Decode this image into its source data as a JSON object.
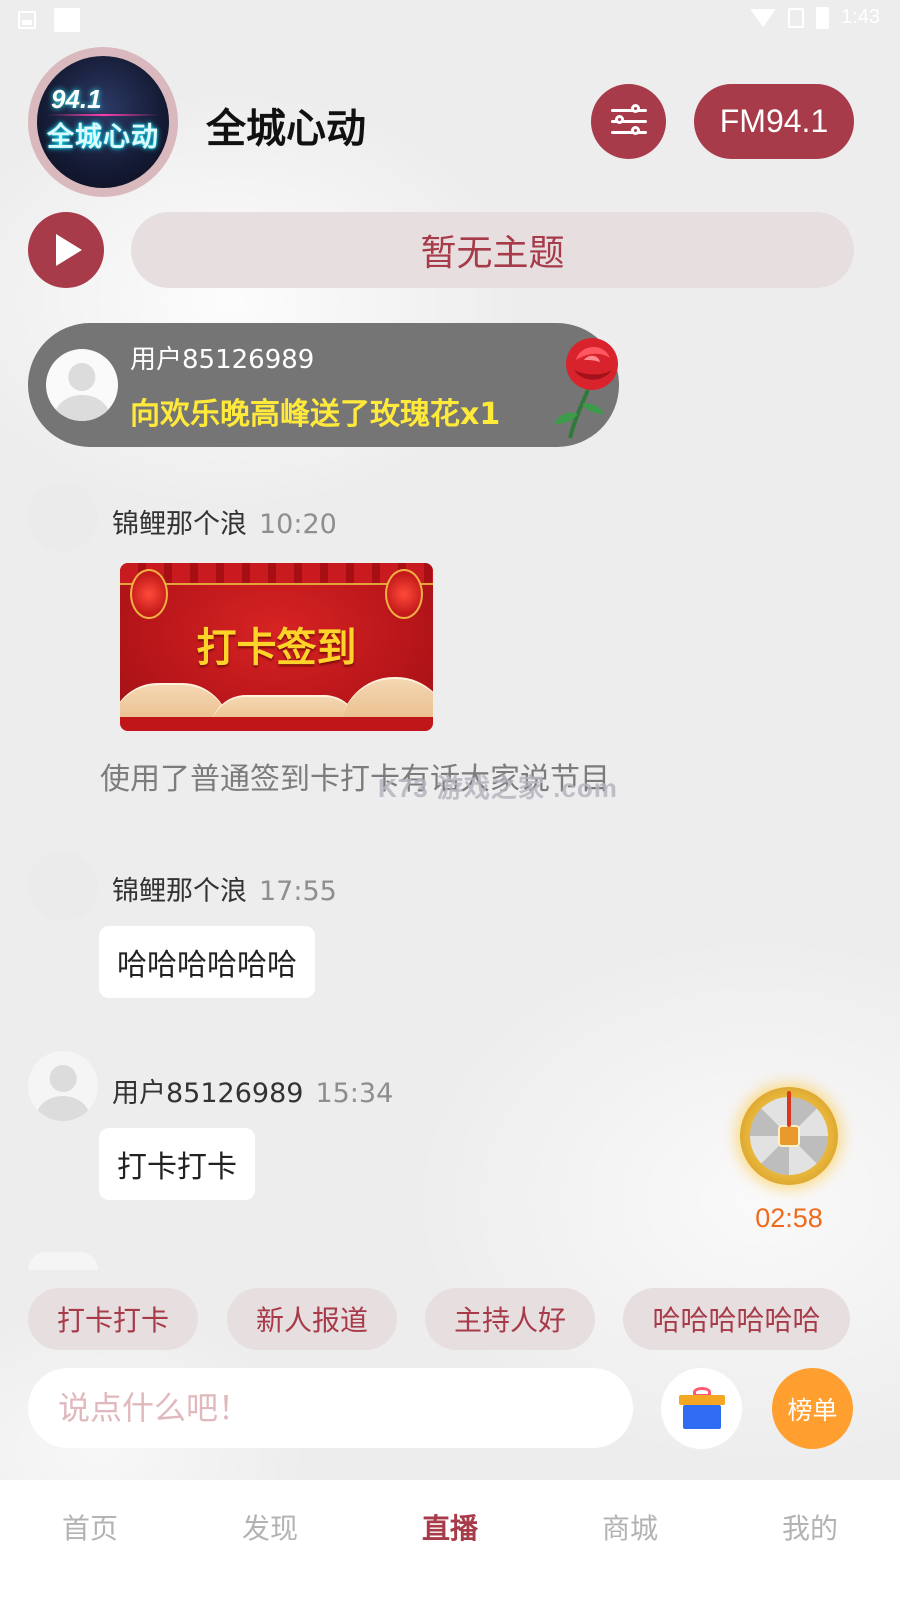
{
  "status_bar": {
    "time": "1:43"
  },
  "station": {
    "logo_number": "94.1",
    "logo_text": "全城心动",
    "name": "全城心动",
    "frequency": "FM94.1"
  },
  "topic": {
    "text": "暂无主题"
  },
  "gift_banner": {
    "user": "用户85126989",
    "message": "向欢乐晚高峰送了玫瑰花x1"
  },
  "messages": [
    {
      "user": "锦鲤那个浪",
      "time": "10:20",
      "card_text": "打卡签到",
      "note": "使用了普通签到卡打卡有话大家说节目"
    },
    {
      "user": "锦鲤那个浪",
      "time": "17:55",
      "text": "哈哈哈哈哈哈"
    },
    {
      "user": "用户85126989",
      "time": "15:34",
      "text": "打卡打卡"
    }
  ],
  "watermark": "K73 游戏之家 .com",
  "lucky_wheel": {
    "timer": "02:58"
  },
  "quick_replies": [
    "打卡打卡",
    "新人报道",
    "主持人好",
    "哈哈哈哈哈哈"
  ],
  "composer": {
    "placeholder": "说点什么吧！",
    "rank_label": "榜单"
  },
  "nav": {
    "items": [
      "首页",
      "发现",
      "直播",
      "商城",
      "我的"
    ],
    "active": "直播"
  },
  "colors": {
    "accent": "#a73b4a",
    "chip_bg": "#e7dfdf",
    "gift_text": "#ffe93a",
    "rank_button": "#ff9f2f",
    "timer": "#ee6a1c"
  }
}
